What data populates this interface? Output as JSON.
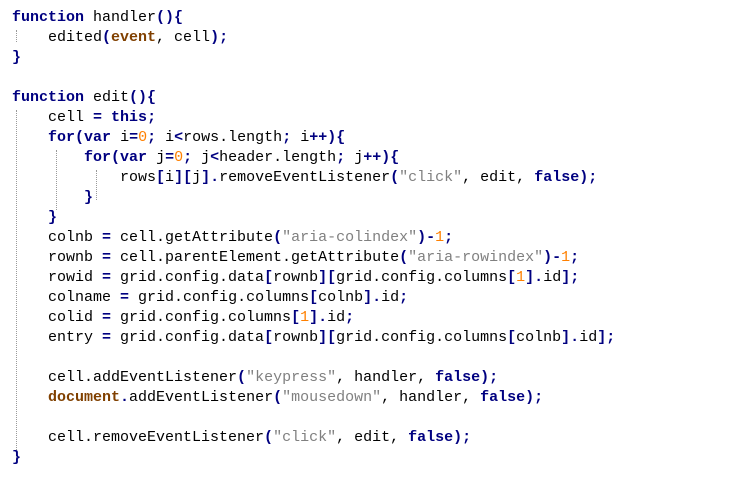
{
  "editor": {
    "lines": [
      [
        {
          "t": "function",
          "c": "kw"
        },
        {
          "t": " handler",
          "c": "pl"
        },
        {
          "t": "(){",
          "c": "op"
        }
      ],
      [
        {
          "t": "    edited",
          "c": "pl"
        },
        {
          "t": "(",
          "c": "op"
        },
        {
          "t": "event",
          "c": "bi"
        },
        {
          "t": ", cell",
          "c": "pl"
        },
        {
          "t": ");",
          "c": "op"
        }
      ],
      [
        {
          "t": "}",
          "c": "op"
        }
      ],
      [],
      [
        {
          "t": "function",
          "c": "kw"
        },
        {
          "t": " edit",
          "c": "pl"
        },
        {
          "t": "(){",
          "c": "op"
        }
      ],
      [
        {
          "t": "    cell ",
          "c": "pl"
        },
        {
          "t": "=",
          "c": "op"
        },
        {
          "t": " ",
          "c": "pl"
        },
        {
          "t": "this",
          "c": "kw"
        },
        {
          "t": ";",
          "c": "op"
        }
      ],
      [
        {
          "t": "    ",
          "c": "pl"
        },
        {
          "t": "for",
          "c": "kw"
        },
        {
          "t": "(",
          "c": "op"
        },
        {
          "t": "var",
          "c": "kw"
        },
        {
          "t": " i",
          "c": "pl"
        },
        {
          "t": "=",
          "c": "op"
        },
        {
          "t": "0",
          "c": "num"
        },
        {
          "t": ";",
          "c": "op"
        },
        {
          "t": " i",
          "c": "pl"
        },
        {
          "t": "<",
          "c": "op"
        },
        {
          "t": "rows.length",
          "c": "pl"
        },
        {
          "t": ";",
          "c": "op"
        },
        {
          "t": " i",
          "c": "pl"
        },
        {
          "t": "++){",
          "c": "op"
        }
      ],
      [
        {
          "t": "        ",
          "c": "pl"
        },
        {
          "t": "for",
          "c": "kw"
        },
        {
          "t": "(",
          "c": "op"
        },
        {
          "t": "var",
          "c": "kw"
        },
        {
          "t": " j",
          "c": "pl"
        },
        {
          "t": "=",
          "c": "op"
        },
        {
          "t": "0",
          "c": "num"
        },
        {
          "t": ";",
          "c": "op"
        },
        {
          "t": " j",
          "c": "pl"
        },
        {
          "t": "<",
          "c": "op"
        },
        {
          "t": "header.length",
          "c": "pl"
        },
        {
          "t": ";",
          "c": "op"
        },
        {
          "t": " j",
          "c": "pl"
        },
        {
          "t": "++){",
          "c": "op"
        }
      ],
      [
        {
          "t": "            rows",
          "c": "pl"
        },
        {
          "t": "[",
          "c": "op"
        },
        {
          "t": "i",
          "c": "pl"
        },
        {
          "t": "][",
          "c": "op"
        },
        {
          "t": "j",
          "c": "pl"
        },
        {
          "t": "].",
          "c": "op"
        },
        {
          "t": "removeEventListener",
          "c": "pl"
        },
        {
          "t": "(",
          "c": "op"
        },
        {
          "t": "\"click\"",
          "c": "str"
        },
        {
          "t": ", edit, ",
          "c": "pl"
        },
        {
          "t": "false",
          "c": "kw"
        },
        {
          "t": ");",
          "c": "op"
        }
      ],
      [
        {
          "t": "        ",
          "c": "pl"
        },
        {
          "t": "}",
          "c": "op"
        }
      ],
      [
        {
          "t": "    ",
          "c": "pl"
        },
        {
          "t": "}",
          "c": "op"
        }
      ],
      [
        {
          "t": "    colnb ",
          "c": "pl"
        },
        {
          "t": "=",
          "c": "op"
        },
        {
          "t": " cell.getAttribute",
          "c": "pl"
        },
        {
          "t": "(",
          "c": "op"
        },
        {
          "t": "\"aria-colindex\"",
          "c": "str"
        },
        {
          "t": ")-",
          "c": "op"
        },
        {
          "t": "1",
          "c": "num"
        },
        {
          "t": ";",
          "c": "op"
        }
      ],
      [
        {
          "t": "    rownb ",
          "c": "pl"
        },
        {
          "t": "=",
          "c": "op"
        },
        {
          "t": " cell.parentElement.getAttribute",
          "c": "pl"
        },
        {
          "t": "(",
          "c": "op"
        },
        {
          "t": "\"aria-rowindex\"",
          "c": "str"
        },
        {
          "t": ")-",
          "c": "op"
        },
        {
          "t": "1",
          "c": "num"
        },
        {
          "t": ";",
          "c": "op"
        }
      ],
      [
        {
          "t": "    rowid ",
          "c": "pl"
        },
        {
          "t": "=",
          "c": "op"
        },
        {
          "t": " grid.config.data",
          "c": "pl"
        },
        {
          "t": "[",
          "c": "op"
        },
        {
          "t": "rownb",
          "c": "pl"
        },
        {
          "t": "][",
          "c": "op"
        },
        {
          "t": "grid.config.columns",
          "c": "pl"
        },
        {
          "t": "[",
          "c": "op"
        },
        {
          "t": "1",
          "c": "num"
        },
        {
          "t": "].",
          "c": "op"
        },
        {
          "t": "id",
          "c": "pl"
        },
        {
          "t": "];",
          "c": "op"
        }
      ],
      [
        {
          "t": "    colname ",
          "c": "pl"
        },
        {
          "t": "=",
          "c": "op"
        },
        {
          "t": " grid.config.columns",
          "c": "pl"
        },
        {
          "t": "[",
          "c": "op"
        },
        {
          "t": "colnb",
          "c": "pl"
        },
        {
          "t": "].",
          "c": "op"
        },
        {
          "t": "id",
          "c": "pl"
        },
        {
          "t": ";",
          "c": "op"
        }
      ],
      [
        {
          "t": "    colid ",
          "c": "pl"
        },
        {
          "t": "=",
          "c": "op"
        },
        {
          "t": " grid.config.columns",
          "c": "pl"
        },
        {
          "t": "[",
          "c": "op"
        },
        {
          "t": "1",
          "c": "num"
        },
        {
          "t": "].",
          "c": "op"
        },
        {
          "t": "id",
          "c": "pl"
        },
        {
          "t": ";",
          "c": "op"
        }
      ],
      [
        {
          "t": "    entry ",
          "c": "pl"
        },
        {
          "t": "=",
          "c": "op"
        },
        {
          "t": " grid.config.data",
          "c": "pl"
        },
        {
          "t": "[",
          "c": "op"
        },
        {
          "t": "rownb",
          "c": "pl"
        },
        {
          "t": "][",
          "c": "op"
        },
        {
          "t": "grid.config.columns",
          "c": "pl"
        },
        {
          "t": "[",
          "c": "op"
        },
        {
          "t": "colnb",
          "c": "pl"
        },
        {
          "t": "].",
          "c": "op"
        },
        {
          "t": "id",
          "c": "pl"
        },
        {
          "t": "];",
          "c": "op"
        }
      ],
      [],
      [
        {
          "t": "    cell.addEventListener",
          "c": "pl"
        },
        {
          "t": "(",
          "c": "op"
        },
        {
          "t": "\"keypress\"",
          "c": "str"
        },
        {
          "t": ", handler, ",
          "c": "pl"
        },
        {
          "t": "false",
          "c": "kw"
        },
        {
          "t": ");",
          "c": "op"
        }
      ],
      [
        {
          "t": "    ",
          "c": "pl"
        },
        {
          "t": "document",
          "c": "bi"
        },
        {
          "t": ".",
          "c": "op"
        },
        {
          "t": "addEventListener",
          "c": "pl"
        },
        {
          "t": "(",
          "c": "op"
        },
        {
          "t": "\"mousedown\"",
          "c": "str"
        },
        {
          "t": ", handler, ",
          "c": "pl"
        },
        {
          "t": "false",
          "c": "kw"
        },
        {
          "t": ");",
          "c": "op"
        }
      ],
      [],
      [
        {
          "t": "    cell.removeEventListener",
          "c": "pl"
        },
        {
          "t": "(",
          "c": "op"
        },
        {
          "t": "\"click\"",
          "c": "str"
        },
        {
          "t": ", edit, ",
          "c": "pl"
        },
        {
          "t": "false",
          "c": "kw"
        },
        {
          "t": ");",
          "c": "op"
        }
      ],
      [
        {
          "t": "}",
          "c": "op"
        }
      ]
    ],
    "colors": {
      "keyword": "#000080",
      "builtin": "#804000",
      "string": "#808080",
      "number": "#ff8000",
      "operator": "#000080",
      "plain": "#000000"
    }
  }
}
